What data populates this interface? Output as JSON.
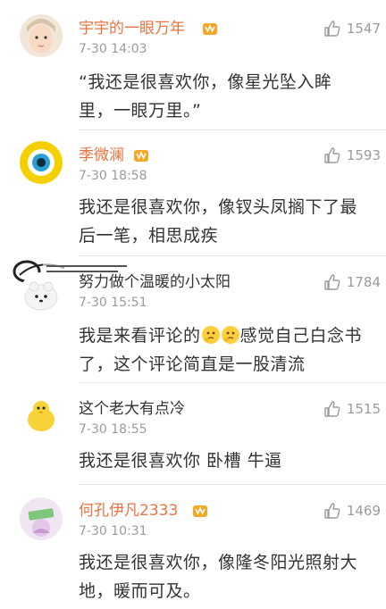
{
  "comments": [
    {
      "username": "宇宇的一眼万年",
      "time": "7-30 14:03",
      "likes": "1547",
      "text": "“我还是很喜欢你，像星光坠入眸里，一眼万里。”",
      "vip": true
    },
    {
      "username": "季微澜",
      "time": "7-30 18:58",
      "likes": "1593",
      "text": "我还是很喜欢你，像钗头凤搁下了最后一笔，相思成疾",
      "vip": true
    },
    {
      "username": "努力做个温暖的小太阳",
      "time": "7-30 15:51",
      "likes": "1784",
      "text_before": "我是来看评论的",
      "text_after": "感觉自己白念书了，这个评论简直是一股清流",
      "vip": false
    },
    {
      "username": "这个老大有点冷",
      "time": "7-30 18:55",
      "likes": "1515",
      "text": "我还是很喜欢你 卧槽 牛逼",
      "vip": false
    },
    {
      "username": "何孔伊凡2333",
      "time": "7-30 10:31",
      "likes": "1469",
      "text": "我还是很喜欢你，像隆冬阳光照射大地，暖而可及。",
      "vip": true
    }
  ],
  "colors": {
    "username_vip": "#eb7340",
    "text": "#333333",
    "meta": "#9b9b9b",
    "divider": "#e6e6e6"
  }
}
